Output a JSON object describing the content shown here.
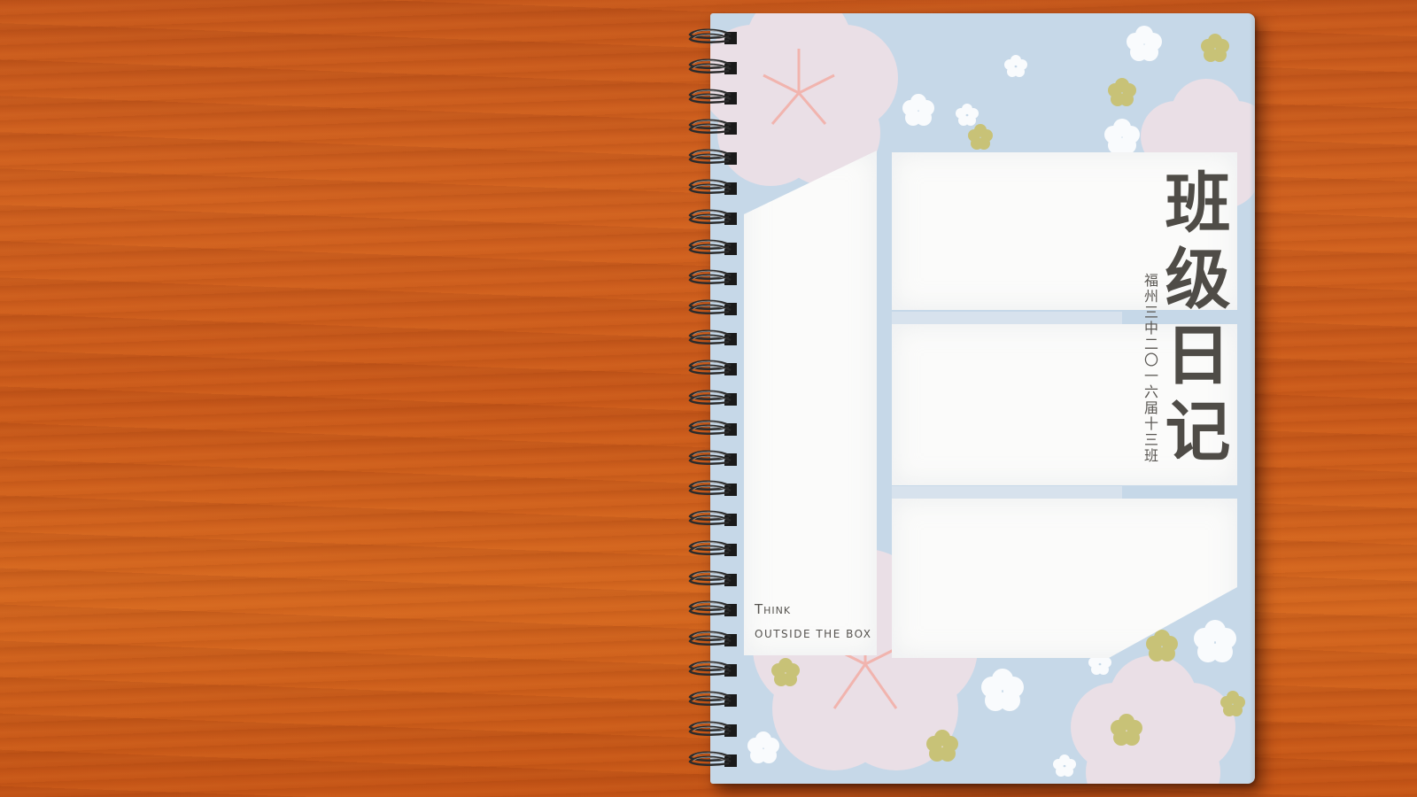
{
  "cover": {
    "title": "班级日记",
    "subtitle": "福州三中二〇一六届十三班",
    "tagline_line1": "Think",
    "tagline_line2": "OUTSIDE THE BOX"
  },
  "colors": {
    "desk": "#c8581a",
    "cover_background": "#c6d8e8",
    "panel": "#fbfbfa",
    "title_text": "#4f4c47",
    "blossom_pink": "#f3dde2",
    "blossom_yellow": "#c8c277",
    "spiral_wire": "#2b2b2b"
  },
  "decorations": {
    "spiral_ring_count": 25,
    "flower_icon": "cherry-blossom-icon"
  }
}
